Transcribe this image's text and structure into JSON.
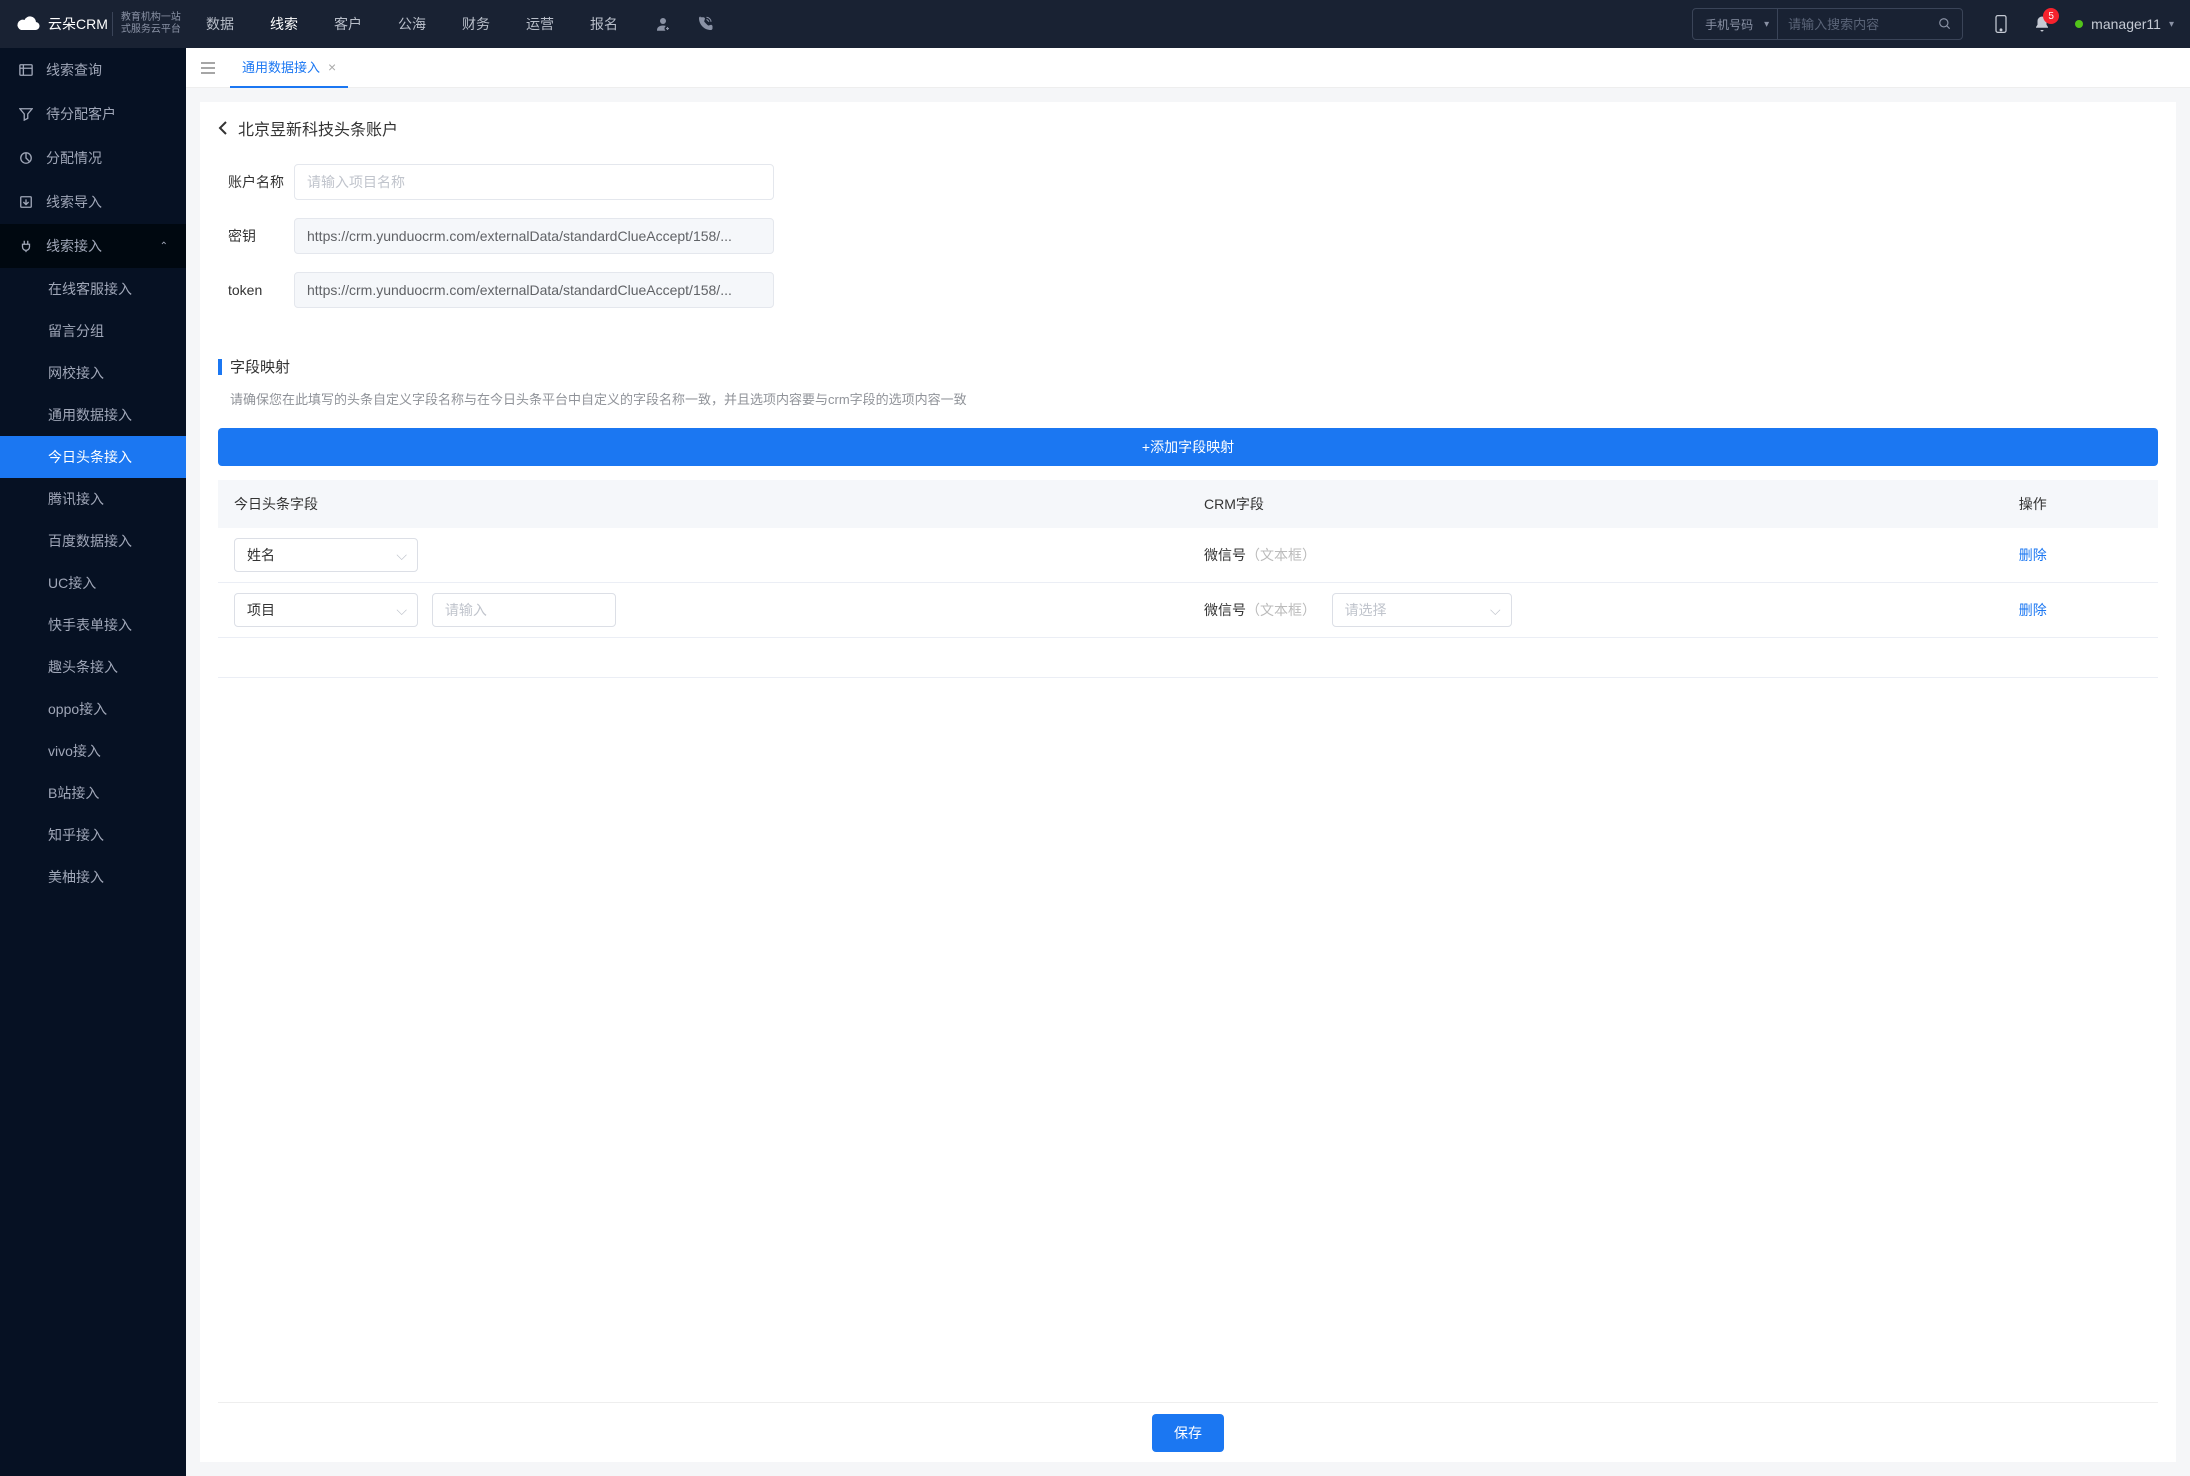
{
  "header": {
    "logo_brand": "云朵CRM",
    "logo_sub1": "教育机构一站",
    "logo_sub2": "式服务云平台",
    "nav": [
      "数据",
      "线索",
      "客户",
      "公海",
      "财务",
      "运营",
      "报名"
    ],
    "nav_active": 1,
    "search_select": "手机号码",
    "search_placeholder": "请输入搜索内容",
    "badge_count": "5",
    "user": "manager11"
  },
  "sidebar": {
    "items": [
      {
        "icon": "list",
        "label": "线索查询"
      },
      {
        "icon": "funnel",
        "label": "待分配客户"
      },
      {
        "icon": "pie",
        "label": "分配情况"
      },
      {
        "icon": "import",
        "label": "线索导入"
      },
      {
        "icon": "plug",
        "label": "线索接入",
        "expanded": true,
        "children": [
          "在线客服接入",
          "留言分组",
          "网校接入",
          "通用数据接入",
          "今日头条接入",
          "腾讯接入",
          "百度数据接入",
          "UC接入",
          "快手表单接入",
          "趣头条接入",
          "oppo接入",
          "vivo接入",
          "B站接入",
          "知乎接入",
          "美柚接入"
        ],
        "active_child": 4
      }
    ]
  },
  "tabs": {
    "active_tab": "通用数据接入"
  },
  "page": {
    "title": "北京昱新科技头条账户",
    "form": {
      "account_label": "账户名称",
      "account_placeholder": "请输入项目名称",
      "secret_label": "密钥",
      "secret_value": "https://crm.yunduocrm.com/externalData/standardClueAccept/158/...",
      "token_label": "token",
      "token_value": "https://crm.yunduocrm.com/externalData/standardClueAccept/158/..."
    },
    "mapping": {
      "title": "字段映射",
      "desc": "请确保您在此填写的头条自定义字段名称与在今日头条平台中自定义的字段名称一致，并且选项内容要与crm字段的选项内容一致",
      "add_btn": "+添加字段映射",
      "columns": [
        "今日头条字段",
        "CRM字段",
        "操作"
      ],
      "rows": [
        {
          "tt_field": "姓名",
          "crm_field": "微信号",
          "crm_hint": "（文本框）"
        },
        {
          "tt_field": "项目",
          "tt_input_placeholder": "请输入",
          "crm_field": "微信号",
          "crm_hint": "（文本框）",
          "crm_select_placeholder": "请选择"
        }
      ],
      "delete_label": "删除"
    },
    "save": "保存"
  }
}
